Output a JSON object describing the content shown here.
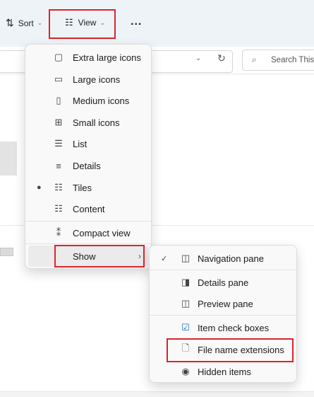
{
  "toolbar": {
    "sort_label": "Sort",
    "view_label": "View",
    "more_label": "..."
  },
  "search": {
    "placeholder": "Search This I"
  },
  "view_menu": {
    "items": [
      {
        "label": "Extra large icons",
        "icon": "extra-large-icons-icon"
      },
      {
        "label": "Large icons",
        "icon": "large-icons-icon"
      },
      {
        "label": "Medium icons",
        "icon": "medium-icons-icon"
      },
      {
        "label": "Small icons",
        "icon": "small-icons-icon"
      },
      {
        "label": "List",
        "icon": "list-icon"
      },
      {
        "label": "Details",
        "icon": "details-icon"
      },
      {
        "label": "Tiles",
        "icon": "tiles-icon",
        "selected": true
      },
      {
        "label": "Content",
        "icon": "content-icon"
      },
      {
        "label": "Compact view",
        "icon": "compact-view-icon"
      },
      {
        "label": "Show",
        "icon": "chevron-right-icon",
        "submenu": true
      }
    ]
  },
  "show_menu": {
    "items": [
      {
        "label": "Navigation pane",
        "icon": "navigation-pane-icon",
        "checked": true
      },
      {
        "label": "Details pane",
        "icon": "details-pane-icon"
      },
      {
        "label": "Preview pane",
        "icon": "preview-pane-icon"
      },
      {
        "label": "Item check boxes",
        "icon": "item-check-boxes-icon"
      },
      {
        "label": "File name extensions",
        "icon": "file-icon"
      },
      {
        "label": "Hidden items",
        "icon": "eye-icon"
      }
    ]
  },
  "colors": {
    "highlight": "#d9262c",
    "toolbar_bg": "#eef3f7",
    "menu_bg": "#f9f9f9"
  }
}
